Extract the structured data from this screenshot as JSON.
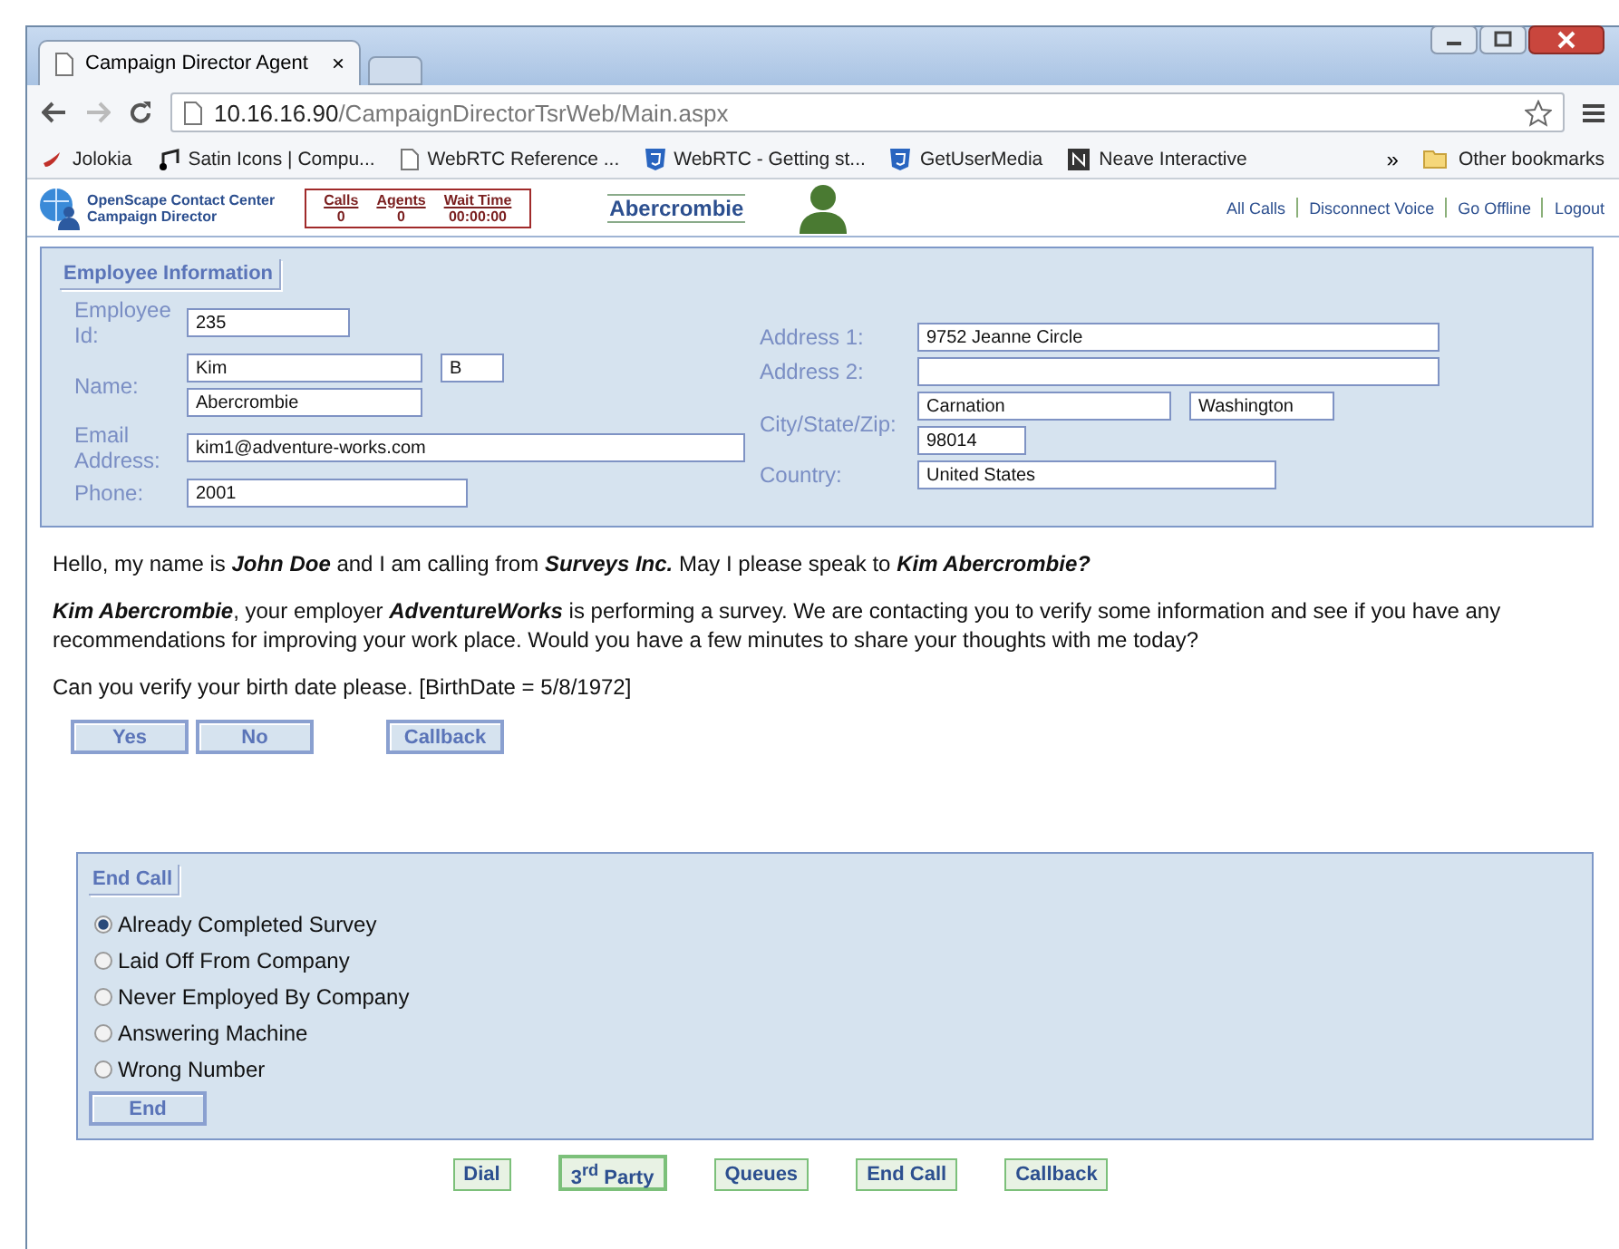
{
  "window": {
    "tab_title": "Campaign Director Agent",
    "tab_close": "×",
    "url_host": "10.16.16.90",
    "url_path": "/CampaignDirectorTsrWeb/Main.aspx"
  },
  "bookmarks": [
    {
      "label": "Jolokia",
      "kind": "chili"
    },
    {
      "label": "Satin Icons | Compu...",
      "kind": "note"
    },
    {
      "label": "WebRTC Reference ...",
      "kind": "page"
    },
    {
      "label": "WebRTC - Getting st...",
      "kind": "shield"
    },
    {
      "label": "GetUserMedia",
      "kind": "shield"
    },
    {
      "label": "Neave Interactive",
      "kind": "dark"
    }
  ],
  "bookmarks_overflow": "»",
  "other_bookmarks": "Other bookmarks",
  "header": {
    "product": [
      "OpenScape Contact Center",
      "Campaign Director"
    ],
    "stats": [
      {
        "label": "Calls",
        "value": "0"
      },
      {
        "label": "Agents",
        "value": "0"
      },
      {
        "label": "Wait Time",
        "value": "00:00:00"
      }
    ],
    "agent_name": "Abercrombie",
    "links": [
      "All Calls",
      "Disconnect Voice",
      "Go Offline",
      "Logout"
    ]
  },
  "employee": {
    "legend": "Employee Information",
    "left": [
      {
        "label": "Employee Id:",
        "inputs": [
          [
            {
              "kind": "filled",
              "value": "235"
            }
          ]
        ]
      },
      {
        "label": "Name:",
        "inputs": [
          [
            {
              "kind": "filled",
              "value": "Kim"
            },
            {
              "kind": "filled",
              "value": "B"
            }
          ],
          [
            {
              "kind": "filled",
              "value": "Abercrombie"
            }
          ]
        ]
      },
      {
        "label": "Email Address:",
        "inputs": [
          [
            {
              "kind": "filled",
              "value": "kim1@adventure-works.com"
            }
          ]
        ]
      },
      {
        "label": "Phone:",
        "inputs": [
          [
            {
              "kind": "filled",
              "value": "2001"
            }
          ]
        ]
      }
    ],
    "right": [
      {
        "label": "Address 1:",
        "inputs": [
          [
            {
              "kind": "filled",
              "value": "9752 Jeanne Circle"
            }
          ]
        ]
      },
      {
        "label": "Address 2:",
        "inputs": [
          [
            {
              "kind": "blank"
            }
          ]
        ]
      },
      {
        "label": "City/State/Zip:",
        "inputs": [
          [
            {
              "kind": "filled",
              "value": "Carnation"
            },
            {
              "kind": "filled",
              "value": "Washington"
            }
          ],
          [
            {
              "kind": "filled",
              "value": "98014"
            }
          ]
        ]
      },
      {
        "label": "Country:",
        "inputs": [
          [
            {
              "kind": "filled",
              "value": "United States"
            }
          ]
        ]
      }
    ]
  },
  "script": [
    "Hello, my name is **John Doe** and I am calling from **Surveys Inc.** May I please speak to **Kim Abercrombie?**",
    "**Kim Abercrombie**, your employer **AdventureWorks** is performing a survey. We are contacting you to verify some information and see if you have any recommendations for improving your work place. Would you have a few minutes to share your thoughts with me today?",
    "Can you verify your birth date please. [BirthDate = 5/8/1972]"
  ],
  "answer_buttons": [
    {
      "label": "Yes",
      "kind": "answer"
    },
    {
      "label": "No",
      "kind": "answer"
    },
    {
      "label": "Callback",
      "kind": "separate"
    }
  ],
  "end_call": {
    "legend": "End Call",
    "options": [
      {
        "label": "Already Completed Survey",
        "selected": true
      },
      {
        "label": "Laid Off From Company",
        "selected": false
      },
      {
        "label": "Never Employed By Company",
        "selected": false
      },
      {
        "label": "Answering Machine",
        "selected": false
      },
      {
        "label": "Wrong Number",
        "selected": false
      }
    ],
    "button": "End"
  },
  "footer_buttons": [
    {
      "label": "Dial",
      "selected": false
    },
    {
      "label": "3$^{rd}$ Party",
      "selected": true
    },
    {
      "label": "Queues",
      "selected": false
    },
    {
      "label": "End Call",
      "selected": false
    },
    {
      "label": "Callback",
      "selected": false
    }
  ]
}
